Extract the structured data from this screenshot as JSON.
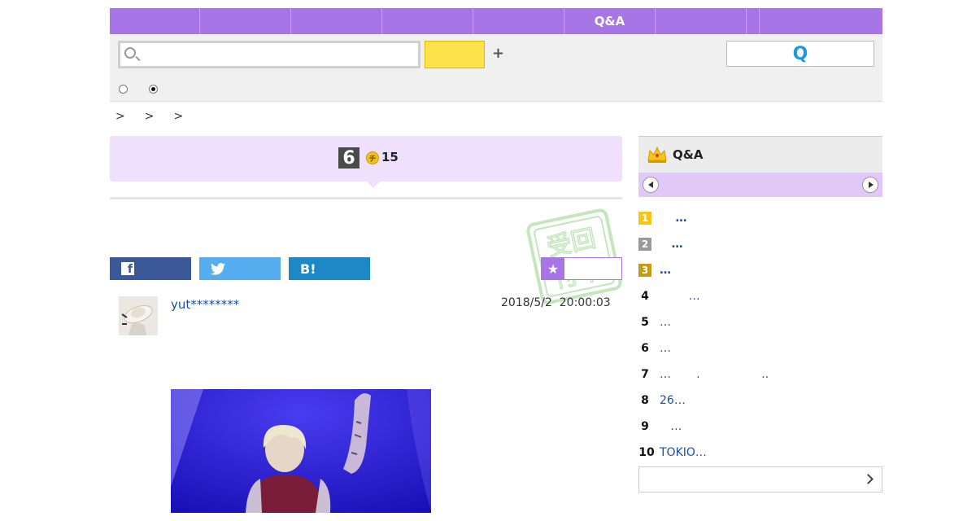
{
  "nav": {
    "items": [
      "",
      "",
      "",
      "",
      "",
      "Q&A",
      "",
      "",
      ""
    ]
  },
  "search": {
    "value": "",
    "placeholder": "",
    "submit_label": "",
    "add_label": "+",
    "qa_button_label": "Q"
  },
  "breadcrumb": {
    "separators": [
      ">",
      ">",
      ">"
    ]
  },
  "question": {
    "answer_count": "6",
    "coin_icon": "チ",
    "coin_value": "15"
  },
  "stamp": {
    "text": "受付中"
  },
  "share": {
    "facebook_icon": "f",
    "twitter_icon": "twitter-bird",
    "hatena_label": "B!",
    "favorite_icon": "★"
  },
  "answer": {
    "username": "yut********",
    "date": "2018/5/2  20:00:03"
  },
  "ranking": {
    "title": "Q&A",
    "items": [
      {
        "rank": "1",
        "title": "    …"
      },
      {
        "rank": "2",
        "title": "   …"
      },
      {
        "rank": "3",
        "title": "…"
      },
      {
        "rank": "4",
        "title": "        …"
      },
      {
        "rank": "5",
        "title": "…"
      },
      {
        "rank": "6",
        "title": "…"
      },
      {
        "rank": "7",
        "title": "…       .                 .."
      },
      {
        "rank": "8",
        "title": "26…"
      },
      {
        "rank": "9",
        "title": "   …"
      },
      {
        "rank": "10",
        "title": "TOKIO…"
      }
    ]
  },
  "colors": {
    "accent": "#a775e6",
    "card": "#efe0fd",
    "link": "#1a4fa8",
    "search_button": "#ffe34d"
  }
}
